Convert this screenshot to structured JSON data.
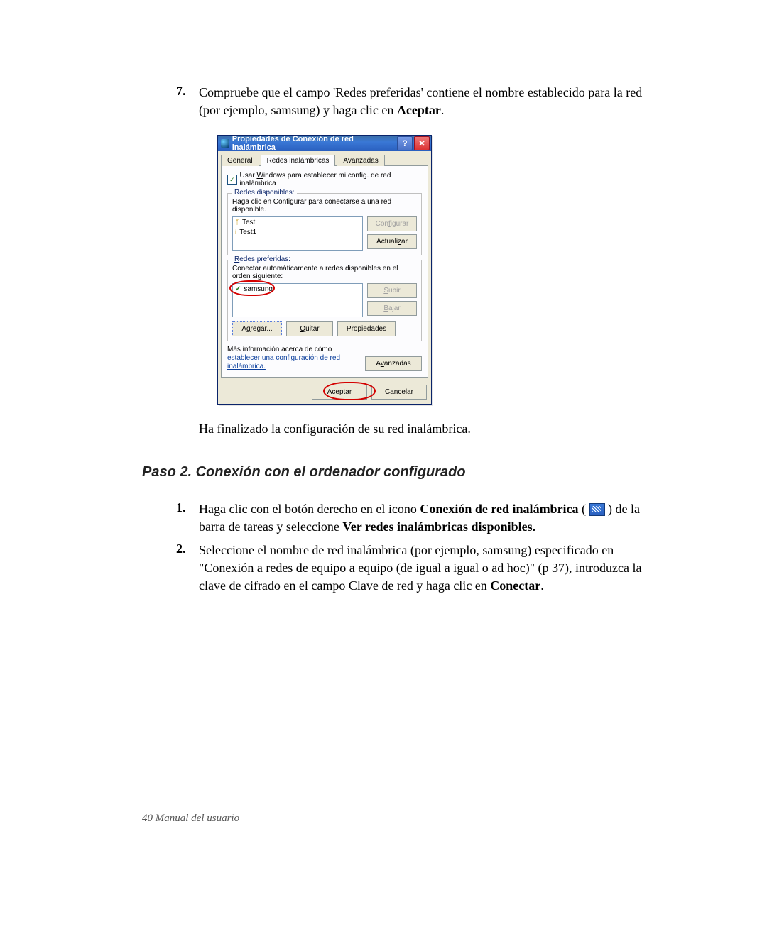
{
  "step7": {
    "num": "7.",
    "text_before_bold": "Compruebe que el campo 'Redes preferidas' contiene el nombre establecido para la red (por ejemplo, samsung) y haga clic en ",
    "bold": "Aceptar",
    "after": "."
  },
  "dialog": {
    "title": "Propiedades de Conexión de red inalámbrica",
    "help_symbol": "?",
    "close_symbol": "✕",
    "tabs": {
      "general": "General",
      "wireless": "Redes inalámbricas",
      "advanced": "Avanzadas"
    },
    "use_windows_label": "Usar Windows para establecer mi config. de red inalámbrica",
    "use_windows_underline": "W",
    "grp1": {
      "legend": "Redes disponibles:",
      "desc": "Haga clic en Configurar para conectarse a una red disponible.",
      "items": [
        "Test",
        "Test1"
      ],
      "btn_configure": "Configurar",
      "btn_refresh": "Actualizar"
    },
    "grp2": {
      "legend": "Redes preferidas:",
      "desc": "Conectar automáticamente a redes disponibles en el orden siguiente:",
      "items": [
        "samsung"
      ],
      "btn_up": "Subir",
      "btn_down": "Bajar",
      "btn_add": "Agregar...",
      "btn_remove": "Quitar",
      "btn_props": "Propiedades"
    },
    "info_text": "Más información acerca de cómo ",
    "info_link1": "establecer una",
    "info_link2": "configuración de red inalámbrica.",
    "btn_adv": "Avanzadas",
    "btn_ok": "Aceptar",
    "btn_cancel": "Cancelar"
  },
  "after_dialog": "Ha finalizado la configuración de su red inalámbrica.",
  "heading2": "Paso 2. Conexión con el ordenador configurado",
  "s2_item1": {
    "num": "1.",
    "a": "Haga clic con el botón derecho en el icono ",
    "b_bold": "Conexión de red inalámbrica",
    "c": " ( ",
    "d": " ) de la barra de tareas y seleccione ",
    "e_bold": "Ver redes inalámbricas disponibles."
  },
  "s2_item2": {
    "num": "2.",
    "a": "Seleccione el nombre de red inalámbrica (por ejemplo, samsung) especificado en \"Conexión a redes de equipo a equipo (de igual a igual o ad hoc)\" (p 37), introduzca la clave de cifrado en el campo Clave de red y haga clic en ",
    "b_bold": "Conectar",
    "c": "."
  },
  "footer": "40  Manual del usuario"
}
